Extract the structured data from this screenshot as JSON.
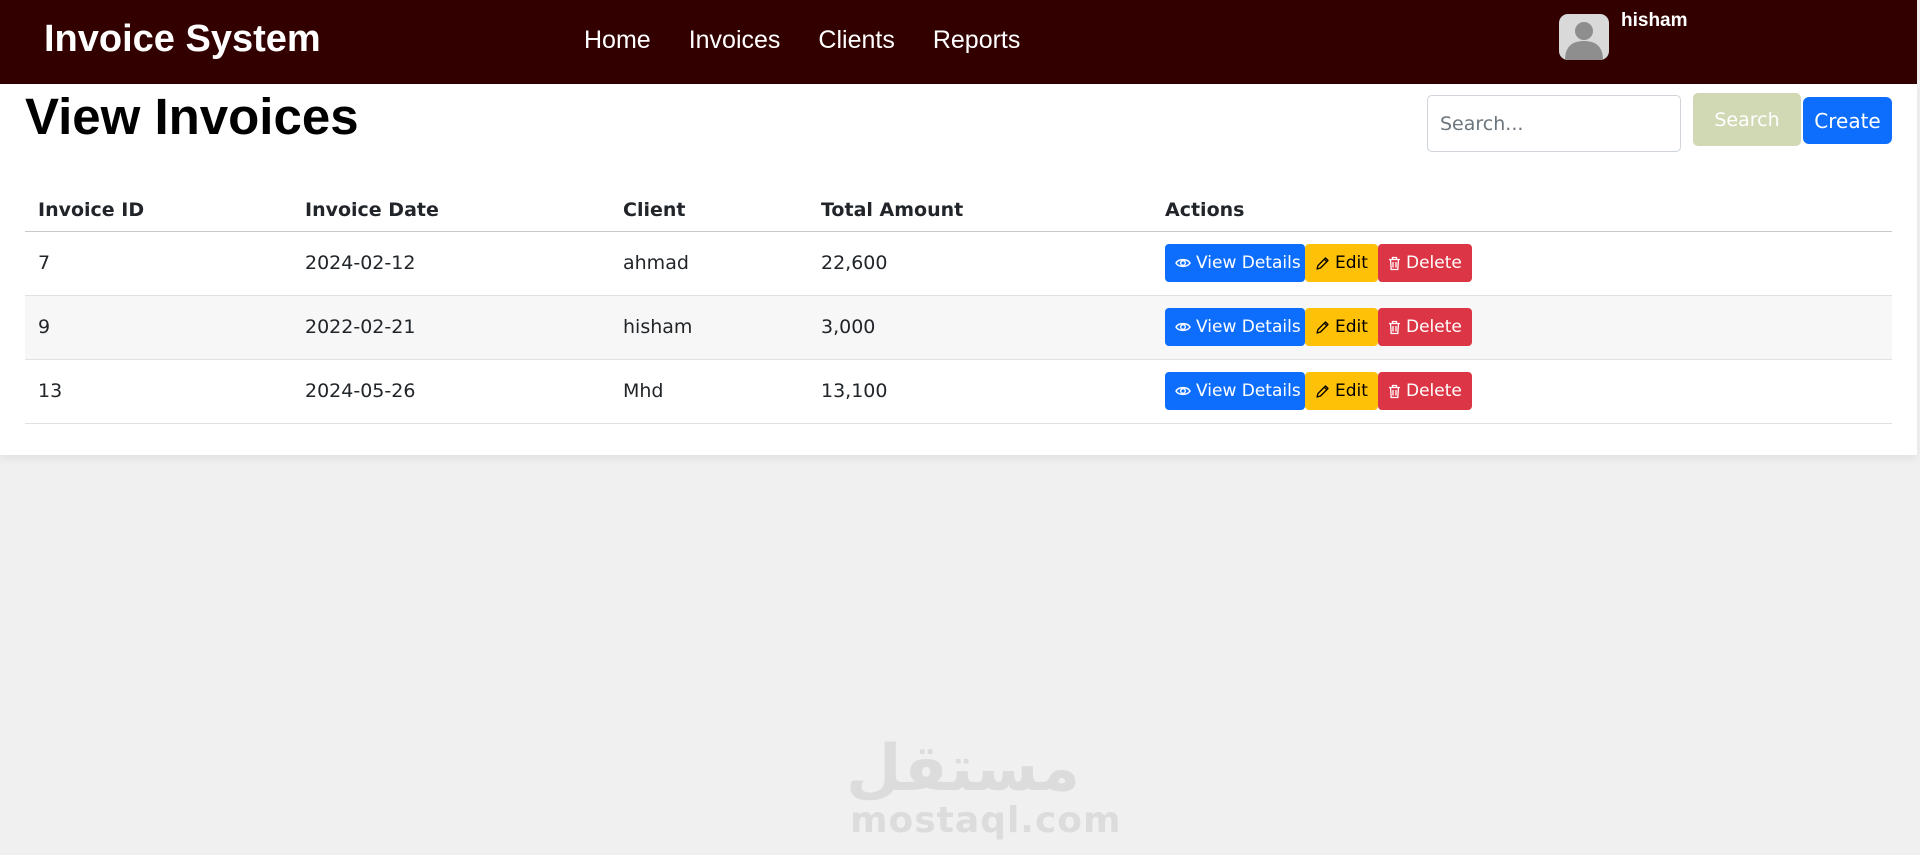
{
  "navbar": {
    "brand": "Invoice System",
    "links": [
      "Home",
      "Invoices",
      "Clients",
      "Reports"
    ],
    "user": {
      "name": "hisham"
    }
  },
  "page": {
    "title": "View Invoices",
    "search": {
      "placeholder": "Search...",
      "button_label": "Search"
    },
    "create_label": "Create"
  },
  "table": {
    "headers": [
      "Invoice ID",
      "Invoice Date",
      "Client",
      "Total Amount",
      "Actions"
    ],
    "rows": [
      {
        "id": "7",
        "date": "2024-02-12",
        "client": "ahmad",
        "total": "22,600"
      },
      {
        "id": "9",
        "date": "2022-02-21",
        "client": "hisham",
        "total": "3,000"
      },
      {
        "id": "13",
        "date": "2024-05-26",
        "client": "Mhd",
        "total": "13,100"
      }
    ],
    "actions": {
      "view": "View Details",
      "edit": "Edit",
      "delete": "Delete"
    }
  },
  "watermark": {
    "arabic": "مستقل",
    "latin": "mostaql.com"
  },
  "colors": {
    "navbar": "#330000",
    "primary": "#0d6efd",
    "warning": "#ffc107",
    "danger": "#dc3545",
    "search_button": "#d1d8b4",
    "background": "#f0f0f0"
  },
  "icons": {
    "view": "eye-icon",
    "edit": "pencil-icon",
    "delete": "trash-icon",
    "avatar": "user-avatar-icon"
  }
}
